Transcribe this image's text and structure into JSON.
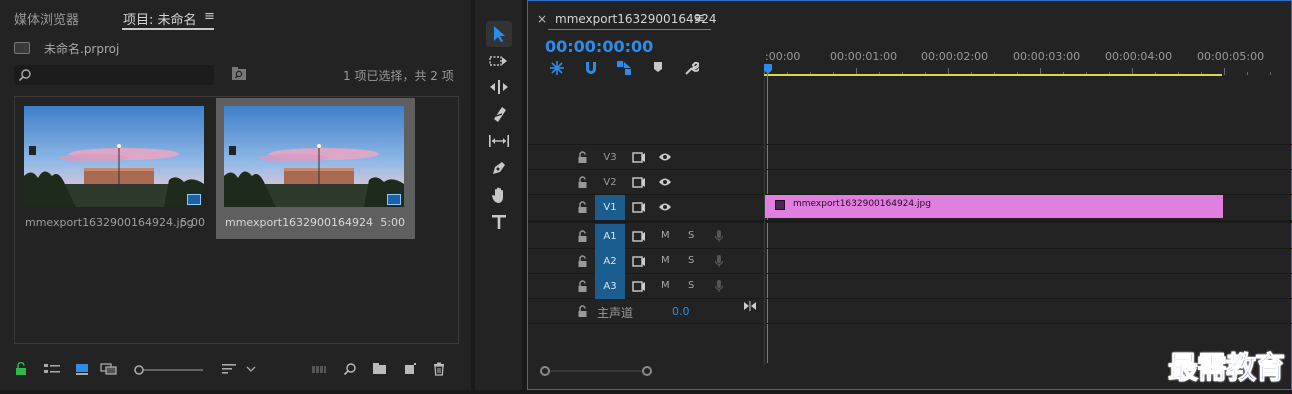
{
  "project_panel": {
    "tabs": [
      {
        "label": "媒体浏览器"
      },
      {
        "label": "项目: 未命名"
      }
    ],
    "menu_glyph": "≡",
    "project_file": "未命名.prproj",
    "search": {
      "value": "",
      "placeholder": ""
    },
    "selection_status": "1 项已选择，共 2 项",
    "clips": [
      {
        "name": "mmexport1632900164924.jpg",
        "duration": "5:00"
      },
      {
        "name": "mmexport1632900164924",
        "duration": "5:00"
      }
    ]
  },
  "timeline": {
    "sequence_title": "mmexport1632900164924",
    "close_glyph": "×",
    "menu_glyph": "≡",
    "timecode": "00:00:00:00",
    "ruler_labels": [
      ":00:00",
      "00:00:01:00",
      "00:00:02:00",
      "00:00:03:00",
      "00:00:04:00",
      "00:00:05:00"
    ],
    "video_tracks": [
      {
        "label": "V3",
        "active": false
      },
      {
        "label": "V2",
        "active": false
      },
      {
        "label": "V1",
        "active": true
      }
    ],
    "audio_tracks": [
      {
        "label": "A1",
        "mute": "M",
        "solo": "S"
      },
      {
        "label": "A2",
        "mute": "M",
        "solo": "S"
      },
      {
        "label": "A3",
        "mute": "M",
        "solo": "S"
      }
    ],
    "master": {
      "label": "主声道",
      "value": "0.0"
    },
    "v1_clip": {
      "name": "mmexport1632900164924.jpg",
      "color": "#e07fe0"
    }
  },
  "colors": {
    "accent": "#2d8ceb",
    "selected_track": "#1c5d8f",
    "work_area": "#d8d84a"
  },
  "watermark": "最需教育"
}
